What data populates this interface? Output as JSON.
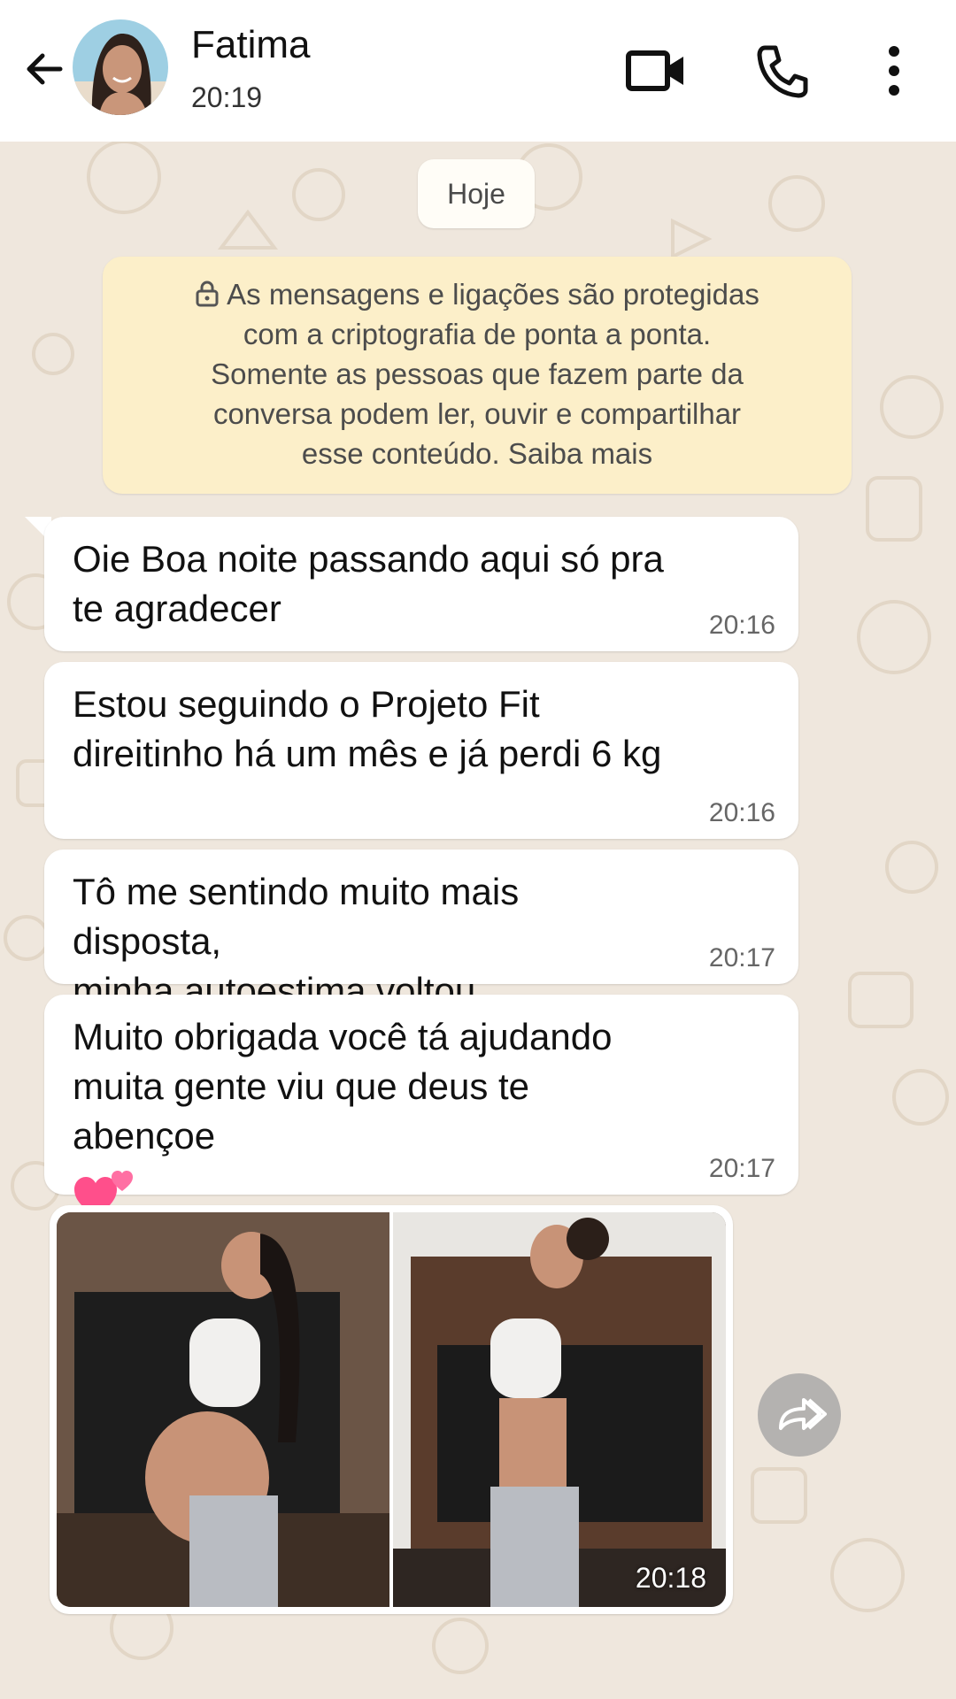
{
  "header": {
    "contact_name": "Fatima",
    "status": "20:19",
    "icons": [
      "back-arrow-icon",
      "video-call-icon",
      "phone-call-icon",
      "more-menu-icon"
    ]
  },
  "chat": {
    "date_chip": "Hoje",
    "encryption_notice": {
      "lines": [
        "As mensagens e ligações são protegidas",
        "com a criptografia de ponta a ponta.",
        "Somente as pessoas que fazem parte da",
        "conversa podem ler, ouvir e compartilhar",
        "esse conteúdo. Saiba mais"
      ]
    },
    "messages": [
      {
        "lines": [
          "Oie Boa noite passando aqui só pra",
          "te agradecer"
        ],
        "time": "20:16"
      },
      {
        "lines": [
          "Estou seguindo o Projeto Fit",
          "direitinho há um mês e já perdi 6 kg"
        ],
        "time": "20:16"
      },
      {
        "lines": [
          "Tô me sentindo muito mais disposta,",
          "minha autoestima voltou"
        ],
        "time": "20:17"
      },
      {
        "lines": [
          "Muito obrigada você tá ajudando",
          "muita gente viu que deus te abençoe"
        ],
        "time": "20:17",
        "emoji": "two-hearts-emoji"
      }
    ],
    "image_message": {
      "time": "20:18",
      "content": "before-after-photo"
    }
  },
  "colors": {
    "chat_bg": "#efe7dd",
    "bubble_bg": "#ffffff",
    "notice_bg": "#fcefc9",
    "heart": "#ff4f8b"
  }
}
